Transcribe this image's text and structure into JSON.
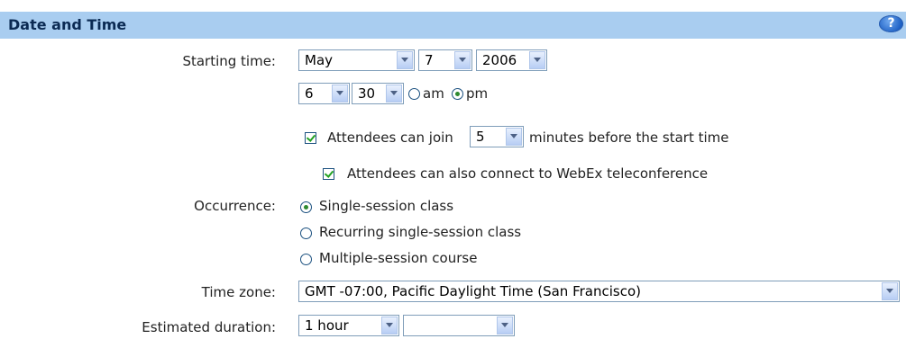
{
  "header": {
    "title": "Date and Time",
    "help_label": "?"
  },
  "starting_time": {
    "label": "Starting time:",
    "month": "May",
    "day": "7",
    "year": "2006",
    "hour": "6",
    "minute": "30",
    "am_label": "am",
    "pm_label": "pm",
    "ampm_selected": "pm"
  },
  "attendees_join": {
    "checked": true,
    "label_before": "Attendees can join",
    "minutes": "5",
    "label_after": "minutes before the start time"
  },
  "teleconference": {
    "checked": true,
    "label": "Attendees can also connect to WebEx teleconference"
  },
  "occurrence": {
    "label": "Occurrence:",
    "options": [
      {
        "label": "Single-session class",
        "selected": true
      },
      {
        "label": "Recurring single-session class",
        "selected": false
      },
      {
        "label": "Multiple-session course",
        "selected": false
      }
    ]
  },
  "time_zone": {
    "label": "Time zone:",
    "value": "GMT -07:00, Pacific Daylight Time (San Francisco)"
  },
  "duration": {
    "label": "Estimated duration:",
    "hours": "1 hour",
    "minutes": ""
  }
}
